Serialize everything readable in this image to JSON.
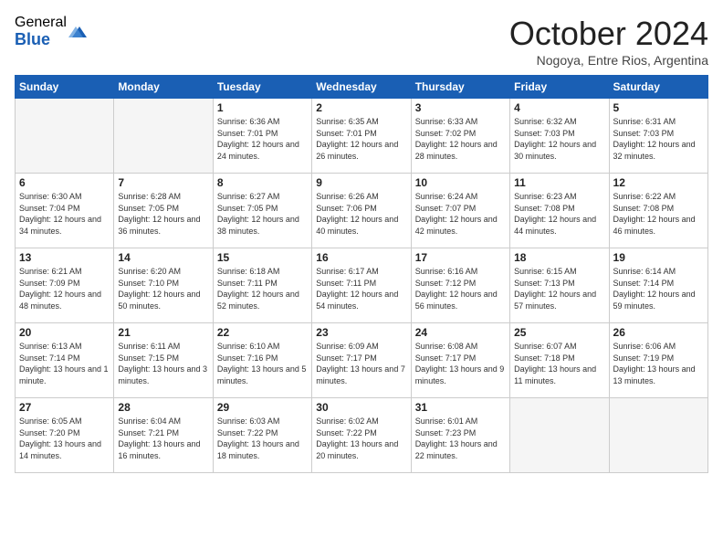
{
  "logo": {
    "general": "General",
    "blue": "Blue"
  },
  "title": "October 2024",
  "subtitle": "Nogoya, Entre Rios, Argentina",
  "days_of_week": [
    "Sunday",
    "Monday",
    "Tuesday",
    "Wednesday",
    "Thursday",
    "Friday",
    "Saturday"
  ],
  "weeks": [
    [
      {
        "day": "",
        "info": ""
      },
      {
        "day": "",
        "info": ""
      },
      {
        "day": "1",
        "info": "Sunrise: 6:36 AM\nSunset: 7:01 PM\nDaylight: 12 hours and 24 minutes."
      },
      {
        "day": "2",
        "info": "Sunrise: 6:35 AM\nSunset: 7:01 PM\nDaylight: 12 hours and 26 minutes."
      },
      {
        "day": "3",
        "info": "Sunrise: 6:33 AM\nSunset: 7:02 PM\nDaylight: 12 hours and 28 minutes."
      },
      {
        "day": "4",
        "info": "Sunrise: 6:32 AM\nSunset: 7:03 PM\nDaylight: 12 hours and 30 minutes."
      },
      {
        "day": "5",
        "info": "Sunrise: 6:31 AM\nSunset: 7:03 PM\nDaylight: 12 hours and 32 minutes."
      }
    ],
    [
      {
        "day": "6",
        "info": "Sunrise: 6:30 AM\nSunset: 7:04 PM\nDaylight: 12 hours and 34 minutes."
      },
      {
        "day": "7",
        "info": "Sunrise: 6:28 AM\nSunset: 7:05 PM\nDaylight: 12 hours and 36 minutes."
      },
      {
        "day": "8",
        "info": "Sunrise: 6:27 AM\nSunset: 7:05 PM\nDaylight: 12 hours and 38 minutes."
      },
      {
        "day": "9",
        "info": "Sunrise: 6:26 AM\nSunset: 7:06 PM\nDaylight: 12 hours and 40 minutes."
      },
      {
        "day": "10",
        "info": "Sunrise: 6:24 AM\nSunset: 7:07 PM\nDaylight: 12 hours and 42 minutes."
      },
      {
        "day": "11",
        "info": "Sunrise: 6:23 AM\nSunset: 7:08 PM\nDaylight: 12 hours and 44 minutes."
      },
      {
        "day": "12",
        "info": "Sunrise: 6:22 AM\nSunset: 7:08 PM\nDaylight: 12 hours and 46 minutes."
      }
    ],
    [
      {
        "day": "13",
        "info": "Sunrise: 6:21 AM\nSunset: 7:09 PM\nDaylight: 12 hours and 48 minutes."
      },
      {
        "day": "14",
        "info": "Sunrise: 6:20 AM\nSunset: 7:10 PM\nDaylight: 12 hours and 50 minutes."
      },
      {
        "day": "15",
        "info": "Sunrise: 6:18 AM\nSunset: 7:11 PM\nDaylight: 12 hours and 52 minutes."
      },
      {
        "day": "16",
        "info": "Sunrise: 6:17 AM\nSunset: 7:11 PM\nDaylight: 12 hours and 54 minutes."
      },
      {
        "day": "17",
        "info": "Sunrise: 6:16 AM\nSunset: 7:12 PM\nDaylight: 12 hours and 56 minutes."
      },
      {
        "day": "18",
        "info": "Sunrise: 6:15 AM\nSunset: 7:13 PM\nDaylight: 12 hours and 57 minutes."
      },
      {
        "day": "19",
        "info": "Sunrise: 6:14 AM\nSunset: 7:14 PM\nDaylight: 12 hours and 59 minutes."
      }
    ],
    [
      {
        "day": "20",
        "info": "Sunrise: 6:13 AM\nSunset: 7:14 PM\nDaylight: 13 hours and 1 minute."
      },
      {
        "day": "21",
        "info": "Sunrise: 6:11 AM\nSunset: 7:15 PM\nDaylight: 13 hours and 3 minutes."
      },
      {
        "day": "22",
        "info": "Sunrise: 6:10 AM\nSunset: 7:16 PM\nDaylight: 13 hours and 5 minutes."
      },
      {
        "day": "23",
        "info": "Sunrise: 6:09 AM\nSunset: 7:17 PM\nDaylight: 13 hours and 7 minutes."
      },
      {
        "day": "24",
        "info": "Sunrise: 6:08 AM\nSunset: 7:17 PM\nDaylight: 13 hours and 9 minutes."
      },
      {
        "day": "25",
        "info": "Sunrise: 6:07 AM\nSunset: 7:18 PM\nDaylight: 13 hours and 11 minutes."
      },
      {
        "day": "26",
        "info": "Sunrise: 6:06 AM\nSunset: 7:19 PM\nDaylight: 13 hours and 13 minutes."
      }
    ],
    [
      {
        "day": "27",
        "info": "Sunrise: 6:05 AM\nSunset: 7:20 PM\nDaylight: 13 hours and 14 minutes."
      },
      {
        "day": "28",
        "info": "Sunrise: 6:04 AM\nSunset: 7:21 PM\nDaylight: 13 hours and 16 minutes."
      },
      {
        "day": "29",
        "info": "Sunrise: 6:03 AM\nSunset: 7:22 PM\nDaylight: 13 hours and 18 minutes."
      },
      {
        "day": "30",
        "info": "Sunrise: 6:02 AM\nSunset: 7:22 PM\nDaylight: 13 hours and 20 minutes."
      },
      {
        "day": "31",
        "info": "Sunrise: 6:01 AM\nSunset: 7:23 PM\nDaylight: 13 hours and 22 minutes."
      },
      {
        "day": "",
        "info": ""
      },
      {
        "day": "",
        "info": ""
      }
    ]
  ]
}
